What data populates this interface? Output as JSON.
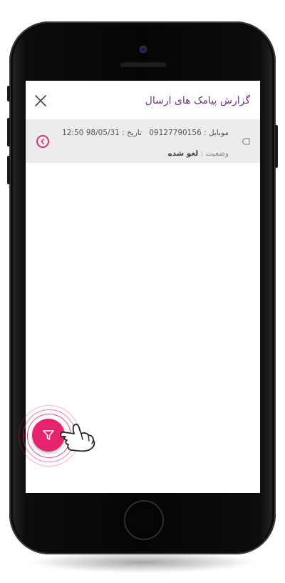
{
  "header": {
    "title": "گزارش پیامک های ارسال",
    "close_icon": "close-icon"
  },
  "sms_report": {
    "items": [
      {
        "mobile_label": "موبایل :",
        "mobile_value": "09127790156",
        "date_label": "تاریخ :",
        "date_value": "98/05/31",
        "time_value": "12:50",
        "status_label": "وضعیت :",
        "status_value": "لغو شده",
        "tag_icon": "tag-icon",
        "arrow_icon": "chevron-left-circle-icon"
      }
    ]
  },
  "fab": {
    "icon": "filter-icon",
    "color": "#e6246e"
  },
  "tap_hint": {
    "icon": "pointing-hand-icon"
  },
  "colors": {
    "title": "#6b3b7a",
    "accent": "#e0307a",
    "card_bg": "#ececec"
  }
}
